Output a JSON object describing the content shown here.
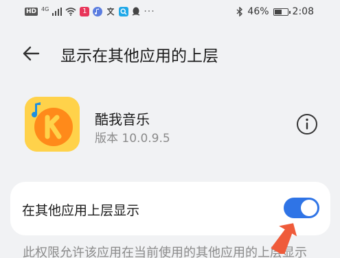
{
  "status_bar": {
    "left_icons": [
      "hd-icon",
      "4g-icon",
      "signal-icon",
      "wifi-icon",
      "app-notification-icon",
      "music-notification-icon",
      "translate-icon",
      "search-notification-icon",
      "qq-icon"
    ],
    "net_label": "4G",
    "hd_label": "HD",
    "more": "···",
    "battery_percent": "46%",
    "battery_level": 0.46,
    "time": "2:08"
  },
  "header": {
    "title": "显示在其他应用的上层"
  },
  "app": {
    "name": "酷我音乐",
    "version": "版本 10.0.9.5",
    "brand_color": "#ffd24a"
  },
  "setting": {
    "label": "在其他应用上层显示",
    "enabled": true,
    "accent_color": "#2f74e6"
  },
  "description": "此权限允许该应用在当前使用的其他应用的上层显示"
}
